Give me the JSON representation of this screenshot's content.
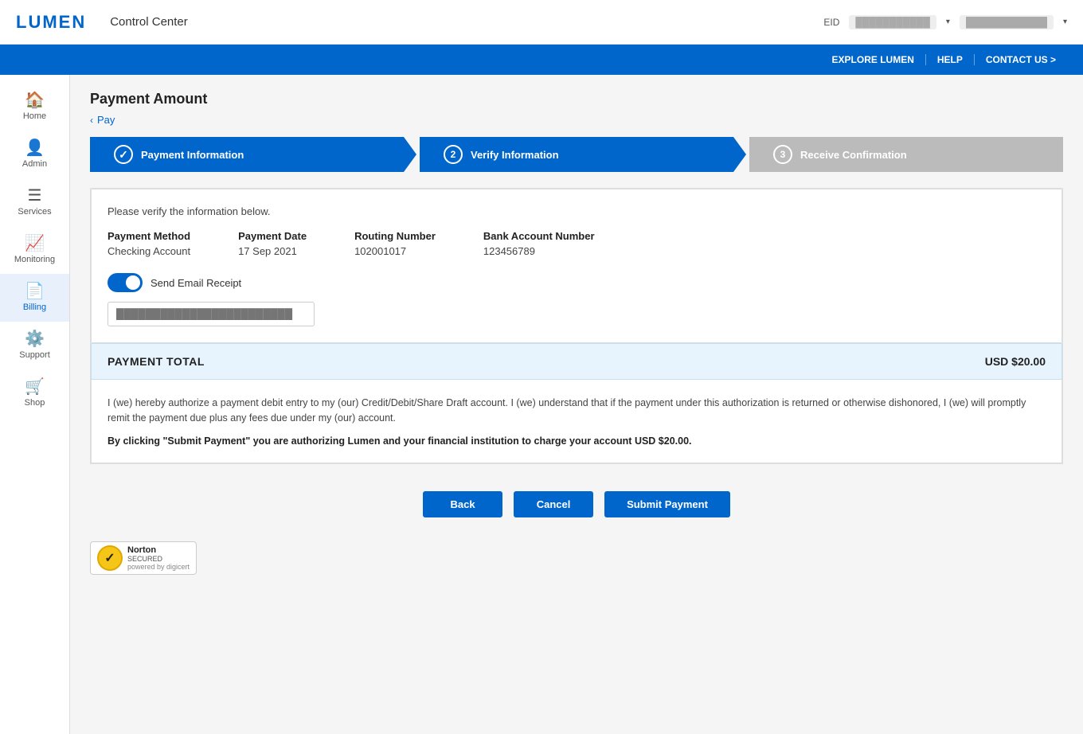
{
  "header": {
    "logo": "LUMEN",
    "app_title": "Control Center",
    "eid_label": "EID",
    "eid_value": "███████████",
    "user_value": "████████████"
  },
  "nav_bar": {
    "links": [
      {
        "label": "EXPLORE LUMEN",
        "id": "explore-lumen"
      },
      {
        "label": "HELP",
        "id": "help"
      },
      {
        "label": "CONTACT US >",
        "id": "contact-us"
      }
    ]
  },
  "sidebar": {
    "items": [
      {
        "label": "Home",
        "icon": "🏠",
        "id": "home",
        "active": false
      },
      {
        "label": "Admin",
        "icon": "👤",
        "id": "admin",
        "active": false
      },
      {
        "label": "Services",
        "icon": "☰",
        "id": "services",
        "active": false
      },
      {
        "label": "Monitoring",
        "icon": "📊",
        "id": "monitoring",
        "active": false
      },
      {
        "label": "Billing",
        "icon": "📄",
        "id": "billing",
        "active": true
      },
      {
        "label": "Support",
        "icon": "⚙️",
        "id": "support",
        "active": false
      },
      {
        "label": "Shop",
        "icon": "🛒",
        "id": "shop",
        "active": false
      }
    ]
  },
  "page": {
    "title": "Payment Amount",
    "breadcrumb_back": "Pay",
    "steps": [
      {
        "number": "1",
        "label": "Payment Information",
        "status": "active",
        "check": true
      },
      {
        "number": "2",
        "label": "Verify Information",
        "status": "active",
        "check": false
      },
      {
        "number": "3",
        "label": "Receive Confirmation",
        "status": "inactive",
        "check": false
      }
    ],
    "verify_text": "Please verify the information below.",
    "payment_info": {
      "columns": [
        {
          "label": "Payment Method",
          "value": "Checking Account"
        },
        {
          "label": "Payment Date",
          "value": "17 Sep 2021"
        },
        {
          "label": "Routing Number",
          "value": "102001017"
        },
        {
          "label": "Bank Account Number",
          "value": "123456789"
        }
      ]
    },
    "email_toggle_label": "Send Email Receipt",
    "email_placeholder": "████████████████████████",
    "payment_total_label": "PAYMENT TOTAL",
    "payment_total_amount": "USD $20.00",
    "auth_text": "I (we) hereby authorize a payment debit entry to my (our) Credit/Debit/Share Draft account. I (we) understand that if the payment under this authorization is returned or otherwise dishonored, I (we) will promptly remit the payment due plus any fees due under my (our) account.",
    "auth_bold": "By clicking \"Submit Payment\" you are authorizing Lumen and your financial institution to charge your account USD $20.00.",
    "buttons": {
      "back": "Back",
      "cancel": "Cancel",
      "submit": "Submit Payment"
    },
    "norton": {
      "title": "Norton",
      "subtitle": "SECURED",
      "powered": "powered by digicert"
    }
  }
}
